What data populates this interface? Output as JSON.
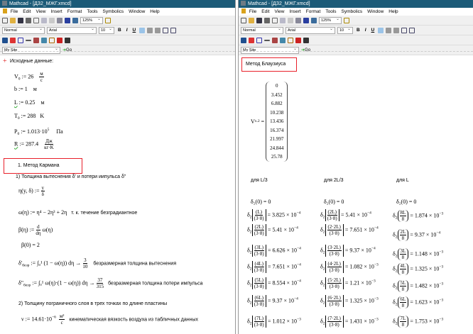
{
  "window_title": "Mathcad - [ДЗ2_МЖГ.xmcd]",
  "menu": [
    "File",
    "Edit",
    "View",
    "Insert",
    "Format",
    "Tools",
    "Symbolics",
    "Window",
    "Help"
  ],
  "toolbar": {
    "zoom": "125%",
    "style": "Normal",
    "font": "Arial",
    "size": "10",
    "bold": "B",
    "italic": "I",
    "underline": "U",
    "site": "My Site",
    "go": "Go"
  },
  "left": {
    "heading": "Исходные данные:",
    "V0": {
      "lhs": "V",
      "sub": "0",
      "val": ":= 26",
      "un": "м",
      "ud": "с"
    },
    "b": {
      "expr": "b := 1",
      "unit": "м"
    },
    "L": {
      "lhs": "L",
      "val": ":= 0.25",
      "unit": "м"
    },
    "T0": {
      "lhs": "T",
      "sub": "0",
      "val": ":= 288",
      "unit": "K"
    },
    "P0": {
      "lhs": "P",
      "sub": "0",
      "val": ":= 1.013·10",
      "exp": "5",
      "unit": "Па"
    },
    "R": {
      "lhs": "R",
      "val": ":= 287.4",
      "un": "Дж",
      "ud": "кг·K"
    },
    "section1": "1. Метод Кармана",
    "sub1": "1) Толщина вытеснения δ' и потери иипульса δ\"",
    "eta": {
      "lhs": "η(y, δ) :=",
      "n": "y",
      "d": "δ"
    },
    "omega": {
      "expr": "ω(η) := η⁴ − 2η³ + 2η",
      "note": "т. к. течение безградиантное"
    },
    "beta": {
      "lhs": "β(η) :=",
      "n": "d",
      "d": "dη",
      "rhs": "ω(η)"
    },
    "beta0": "β(0) = 2",
    "d1": {
      "lhs": "δ'",
      "sub": "безр",
      "expr": ":= ∫₀¹ (1 − ω(η)) dη →",
      "n": "3",
      "d": "10",
      "note": "безразмерная толщина вытеснения"
    },
    "d2": {
      "lhs": "δ\"",
      "sub": "безр",
      "expr": ":= ∫₀¹ ω(η)·(1 − ω(η)) dη →",
      "n": "37",
      "d": "315",
      "note": "безразмерная толщина потери импульса"
    },
    "sub2": "2) Толщину  пограничного слоя в трех точках по длине пластины",
    "nu": {
      "expr": "ν := 14.61·10",
      "exp": "−6",
      "un": "м²",
      "ud": "с",
      "note": "кинематическая вязкость воздуха из табличных данных"
    }
  },
  "right": {
    "section": "Метод Блаузиуса",
    "vx_label": "V",
    "vx_sub": "x.2",
    "vx_eq": "=",
    "vx": [
      "0",
      "3.452",
      "6.882",
      "10.238",
      "13.436",
      "16.374",
      "21.997",
      "24.844",
      "25.78"
    ],
    "columns": [
      {
        "header": "для L/3",
        "zero": "δ₂(0) = 0",
        "rows": [
          {
            "n": "(L)",
            "d": "(3·8)",
            "v": "= 3.825 × 10",
            "e": "−4"
          },
          {
            "n": "(2L)",
            "d": "(3·8)",
            "v": "= 5.41 × 10",
            "e": "−4"
          },
          {
            "n": "(3L)",
            "d": "(3·8)",
            "v": "= 6.626 × 10",
            "e": "−4"
          },
          {
            "n": "(4L)",
            "d": "(3·8)",
            "v": "= 7.651 × 10",
            "e": "−4"
          },
          {
            "n": "(5L)",
            "d": "(3·8)",
            "v": "= 8.554 × 10",
            "e": "−4"
          },
          {
            "n": "(6L)",
            "d": "(3·8)",
            "v": "= 9.37 × 10",
            "e": "−4"
          },
          {
            "n": "(7L)",
            "d": "(3·8)",
            "v": "= 1.012 × 10",
            "e": "−3"
          }
        ]
      },
      {
        "header": "для 2L/3",
        "zero": "δ₂(0) = 0",
        "rows": [
          {
            "n": "(2L)",
            "d": "(3·8)",
            "v": "= 5.41 × 10",
            "e": "−4"
          },
          {
            "n": "(2·2L)",
            "d": "(3·8)",
            "v": "= 7.651 × 10",
            "e": "−4"
          },
          {
            "n": "(3·2L)",
            "d": "(3·8)",
            "v": "= 9.37 × 10",
            "e": "−4"
          },
          {
            "n": "(4·2L)",
            "d": "(3·8)",
            "v": "= 1.082 × 10",
            "e": "−3"
          },
          {
            "n": "(5·2L)",
            "d": "(3·8)",
            "v": "= 1.21 × 10",
            "e": "−3"
          },
          {
            "n": "(6·2L)",
            "d": "(3·8)",
            "v": "= 1.325 × 10",
            "e": "−3"
          },
          {
            "n": "(7·2L)",
            "d": "(3·8)",
            "v": "= 1.431 × 10",
            "e": "−3"
          }
        ]
      },
      {
        "header": "для L",
        "zero": "δ₂(0) = 0",
        "rows": [
          {
            "n": "8L",
            "d": "8",
            "v": "= 1.874 × 10",
            "e": "−3"
          },
          {
            "n": "2L",
            "d": "8",
            "v": "= 9.37 × 10",
            "e": "−4"
          },
          {
            "n": "3L",
            "d": "8",
            "v": "= 1.148 × 10",
            "e": "−3"
          },
          {
            "n": "4L",
            "d": "8",
            "v": "= 1.325 × 10",
            "e": "−3"
          },
          {
            "n": "5L",
            "d": "8",
            "v": "= 1.482 × 10",
            "e": "−3"
          },
          {
            "n": "6L",
            "d": "8",
            "v": "= 1.623 × 10",
            "e": "−3"
          },
          {
            "n": "7L",
            "d": "8",
            "v": "= 1.753 × 10",
            "e": "−3"
          }
        ]
      }
    ]
  }
}
